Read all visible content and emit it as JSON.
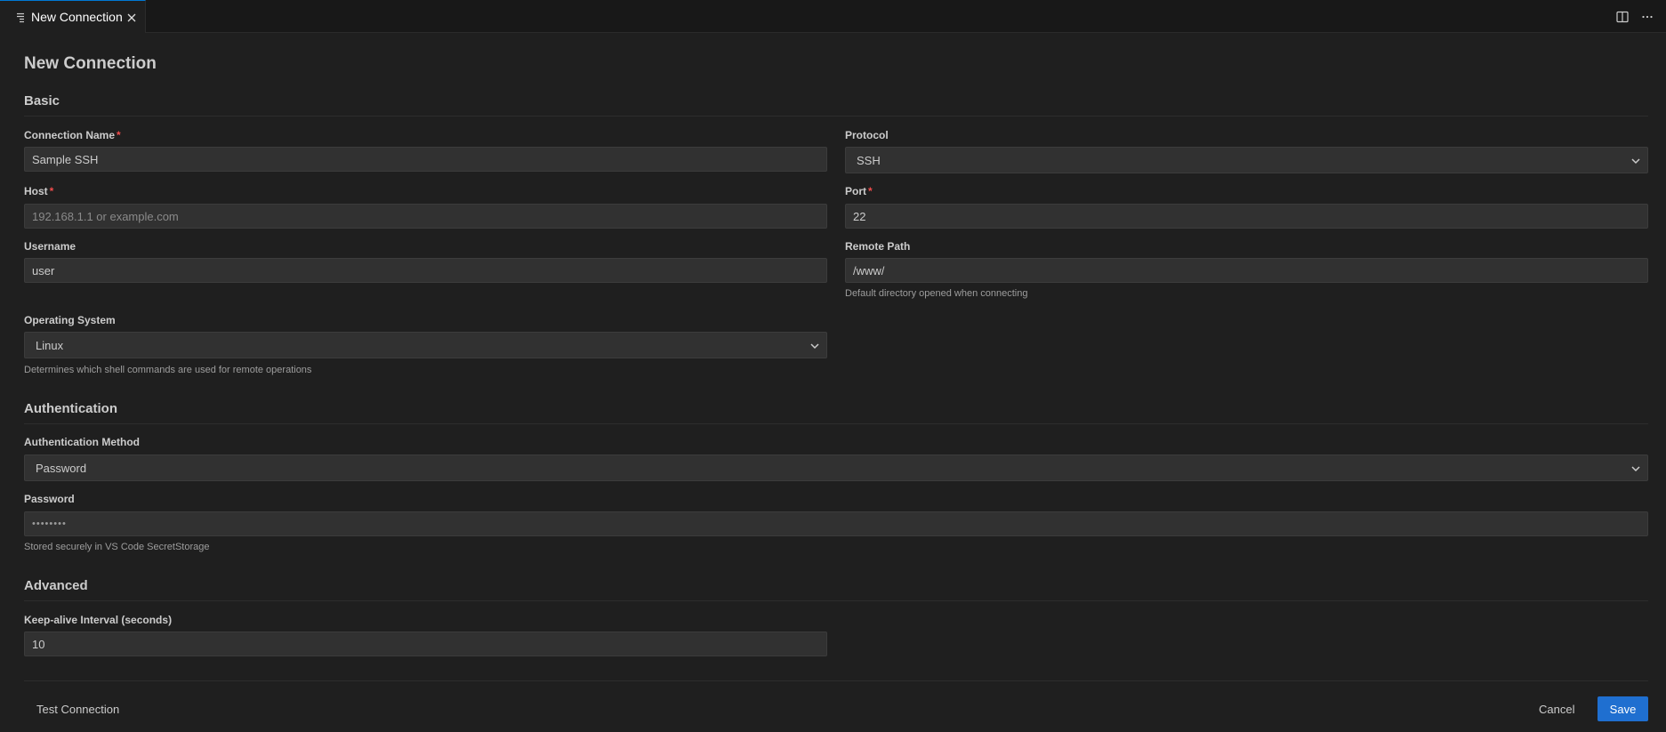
{
  "tab": {
    "title": "New Connection"
  },
  "page": {
    "title": "New Connection"
  },
  "sections": {
    "basic": "Basic",
    "authentication": "Authentication",
    "advanced": "Advanced"
  },
  "fields": {
    "connection_name": {
      "label": "Connection Name",
      "required": "*",
      "value": "Sample SSH"
    },
    "protocol": {
      "label": "Protocol",
      "value": "SSH"
    },
    "host": {
      "label": "Host",
      "required": "*",
      "placeholder": "192.168.1.1 or example.com"
    },
    "port": {
      "label": "Port",
      "required": "*",
      "value": "22"
    },
    "username": {
      "label": "Username",
      "value": "user"
    },
    "remote_path": {
      "label": "Remote Path",
      "value": "/www/",
      "hint": "Default directory opened when connecting"
    },
    "operating_system": {
      "label": "Operating System",
      "value": "Linux",
      "hint": "Determines which shell commands are used for remote operations"
    },
    "auth_method": {
      "label": "Authentication Method",
      "value": "Password"
    },
    "password": {
      "label": "Password",
      "value": "••••••••",
      "hint": "Stored securely in VS Code SecretStorage"
    },
    "keepalive": {
      "label": "Keep-alive Interval (seconds)",
      "value": "10"
    }
  },
  "footer": {
    "test_connection": "Test Connection",
    "cancel": "Cancel",
    "save": "Save"
  },
  "icons": {
    "tab": "preview-icon",
    "close": "close-icon",
    "split": "split-editor-icon",
    "more": "more-actions-icon",
    "chevron": "chevron-down-icon"
  },
  "colors": {
    "accent": "#1f6fd0",
    "required": "#f14c4c",
    "background": "#1f1f1f"
  }
}
